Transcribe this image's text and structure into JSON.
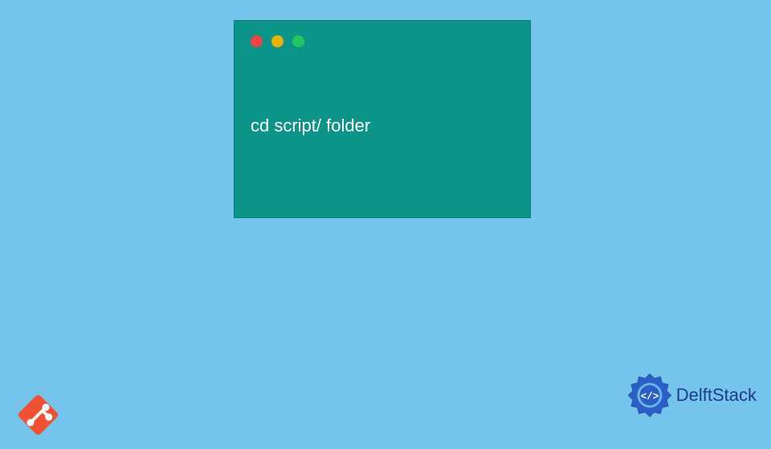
{
  "terminal": {
    "command": "cd script/ folder"
  },
  "branding": {
    "delft_label": "DelftStack"
  },
  "colors": {
    "background": "#74c4ec",
    "terminal": "#0d9488",
    "dot_red": "#ef4444",
    "dot_yellow": "#eab308",
    "dot_green": "#22c55e",
    "git_orange": "#f05133",
    "delft_blue": "#1e3a8a"
  }
}
